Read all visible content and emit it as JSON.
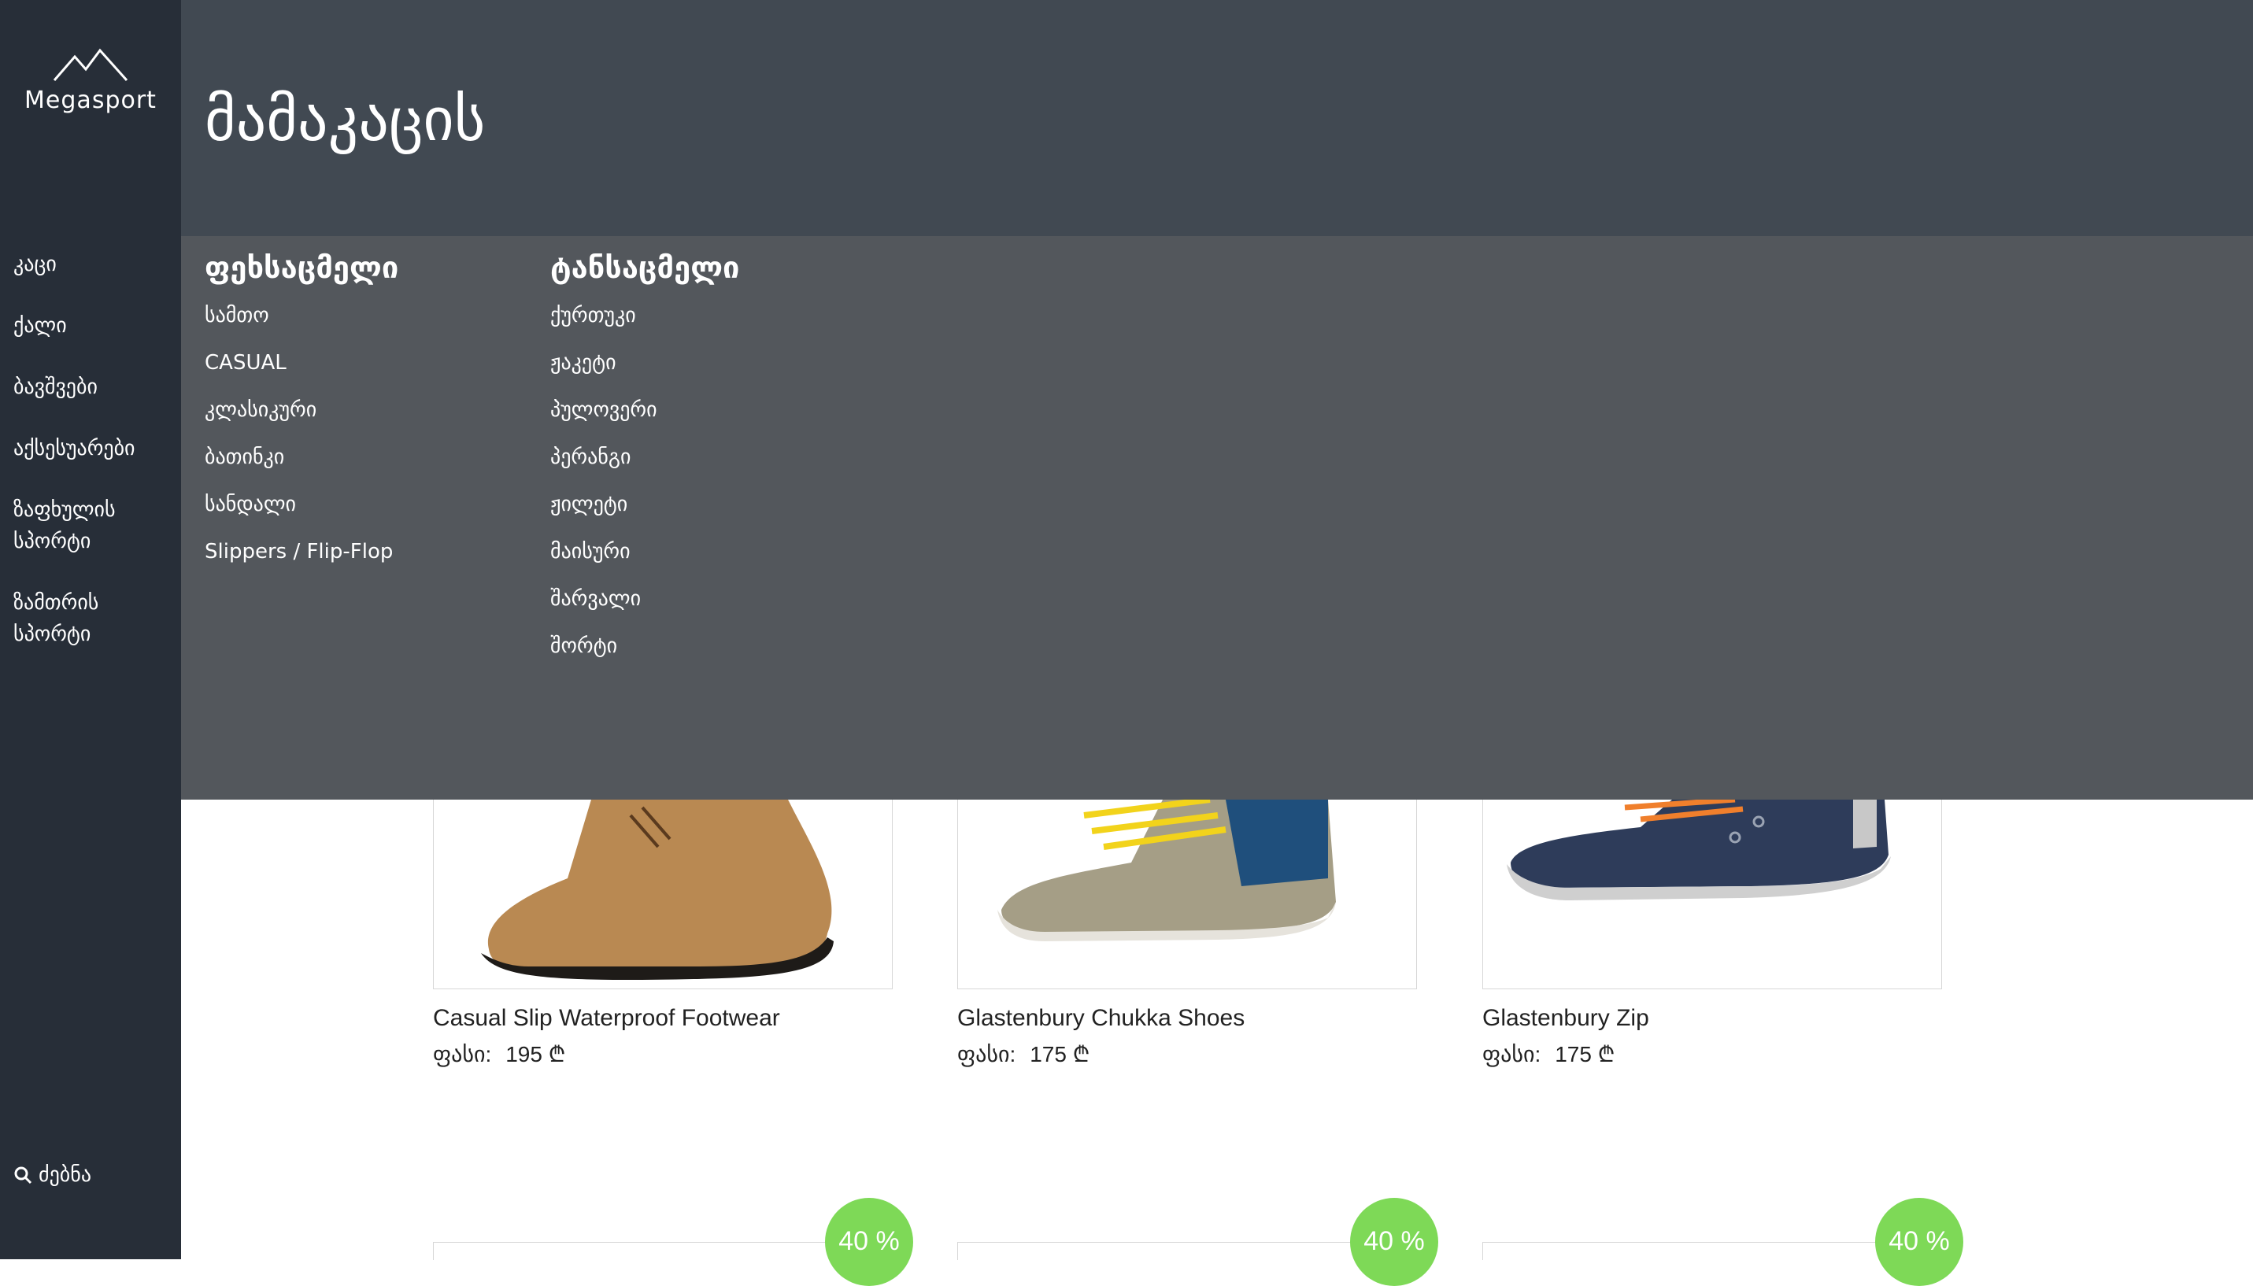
{
  "brand": {
    "name": "Megasport"
  },
  "sidebar": {
    "items": [
      {
        "label": "კაცი"
      },
      {
        "label": "ქალი"
      },
      {
        "label": "ბავშვები"
      },
      {
        "label": "აქსესუარები"
      },
      {
        "label": "ზაფხულის სპორტი"
      },
      {
        "label": "ზამთრის სპორტი"
      }
    ],
    "search_label": "ძებნა"
  },
  "header": {
    "title": "მამაკაცის"
  },
  "mega_menu": {
    "footwear": {
      "heading": "ფეხსაცმელი",
      "items": [
        "სამთო",
        "CASUAL",
        "კლასიკური",
        "ბათინკი",
        "სანდალი",
        "Slippers / Flip-Flop"
      ]
    },
    "clothing": {
      "heading": "ტანსაცმელი",
      "items": [
        "ქურთუკი",
        "ჟაკეტი",
        "პულოვერი",
        "პერანგი",
        "ჟილეტი",
        "მაისური",
        "შარვალი",
        "შორტი"
      ]
    }
  },
  "products": [
    {
      "name": "Casual Slip Waterproof Footwear",
      "price_label": "ფასი:",
      "price": "195 ₾"
    },
    {
      "name": "Glastenbury Chukka Shoes",
      "price_label": "ფასი:",
      "price": "175 ₾"
    },
    {
      "name": "Glastenbury Zip",
      "price_label": "ფასი:",
      "price": "175 ₾"
    }
  ],
  "discount_badges": [
    "40 %",
    "40 %",
    "40 %"
  ],
  "colors": {
    "sidebar": "#272e38",
    "header": "#414952",
    "mega_menu": "#53575c",
    "badge": "#7ed957"
  }
}
